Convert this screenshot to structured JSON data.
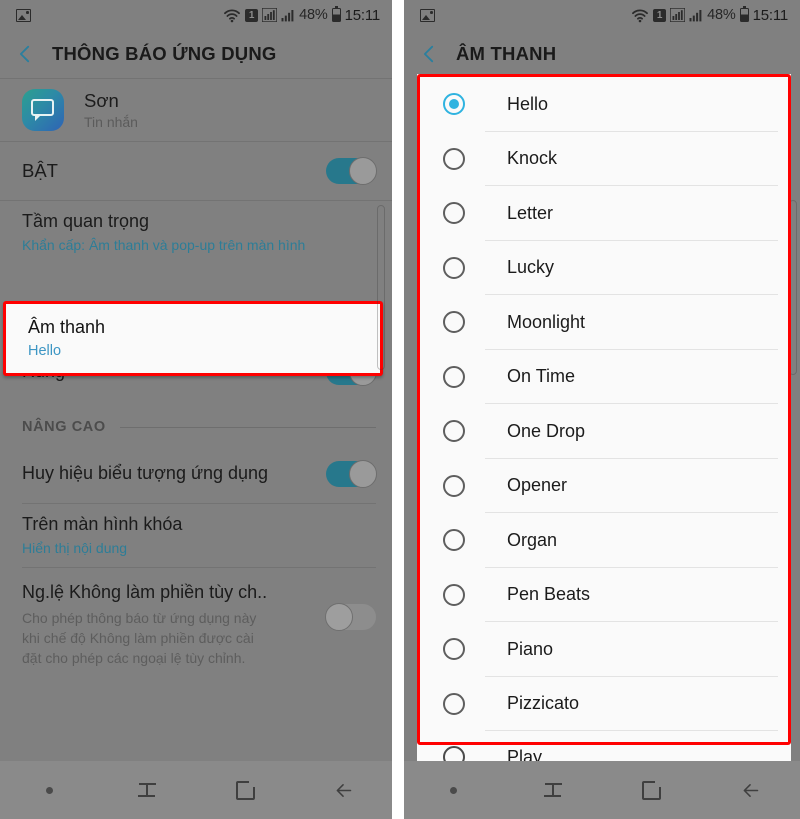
{
  "status_bar": {
    "photo_icon": "photo-icon",
    "wifi_icon": "wifi-icon",
    "sim_label": "1",
    "signal_icon_1": "signal-bars-icon",
    "signal_icon_2": "signal-bars-icon",
    "battery_percent": "48%",
    "battery_icon": "battery-icon",
    "time": "15:11"
  },
  "left_panel": {
    "appbar": {
      "back_icon": "back-chevron-icon",
      "title": "THÔNG BÁO ỨNG DỤNG"
    },
    "app_header": {
      "icon": "messages-app-icon",
      "name": "Sơn",
      "subtitle": "Tin nhắn"
    },
    "rows": [
      {
        "name": "row-enable",
        "title": "BẬT",
        "subtitle": "",
        "toggle": "on"
      },
      {
        "name": "row-importance",
        "title": "Tầm quan trọng",
        "subtitle": "Khẩn cấp: Âm thanh và pop-up trên màn hình",
        "toggle": "none"
      },
      {
        "name": "row-vibrate",
        "title": "Rung",
        "subtitle": "",
        "toggle": "on"
      }
    ],
    "highlighted_row": {
      "title": "Âm thanh",
      "subtitle": "Hello",
      "highlight_color": "#ff0000"
    },
    "section_advanced": "NÂNG CAO",
    "advanced_rows": [
      {
        "name": "row-app-icon-badges",
        "title": "Huy hiệu biểu tượng ứng dụng",
        "subtitle": "",
        "toggle": "on"
      },
      {
        "name": "row-lock-screen",
        "title": "Trên màn hình khóa",
        "subtitle": "Hiển thị nội dung",
        "toggle": "none"
      },
      {
        "name": "row-dnd-exception",
        "title": "Ng.lệ Không làm phiền tùy ch..",
        "subtitle": "Cho phép thông báo từ ứng dụng này khi chế độ Không làm phiền được cài đặt cho phép các ngoại lệ tùy chỉnh.",
        "toggle": "off"
      }
    ]
  },
  "right_panel": {
    "appbar": {
      "back_icon": "back-chevron-icon",
      "title": "ÂM THANH"
    },
    "highlight_color": "#ff0000",
    "selected_sound": "Hello",
    "sounds": [
      {
        "label": "Hello",
        "selected": true
      },
      {
        "label": "Knock",
        "selected": false
      },
      {
        "label": "Letter",
        "selected": false
      },
      {
        "label": "Lucky",
        "selected": false
      },
      {
        "label": "Moonlight",
        "selected": false
      },
      {
        "label": "On Time",
        "selected": false
      },
      {
        "label": "One Drop",
        "selected": false
      },
      {
        "label": "Opener",
        "selected": false
      },
      {
        "label": "Organ",
        "selected": false
      },
      {
        "label": "Pen Beats",
        "selected": false
      },
      {
        "label": "Piano",
        "selected": false
      },
      {
        "label": "Pizzicato",
        "selected": false
      }
    ],
    "partial_sound": {
      "label": "Play",
      "selected": false
    }
  },
  "nav_bar": {
    "dot_icon": "dot-icon",
    "recents_icon": "recents-icon",
    "home_icon": "home-icon",
    "back_icon": "back-arrow-icon"
  },
  "colors": {
    "accent_teal": "#27788c",
    "accent_link": "#2d7d97",
    "radio_selected": "#2fb3e0",
    "highlight_red": "#ff0000",
    "panel_bg": "#808080"
  }
}
